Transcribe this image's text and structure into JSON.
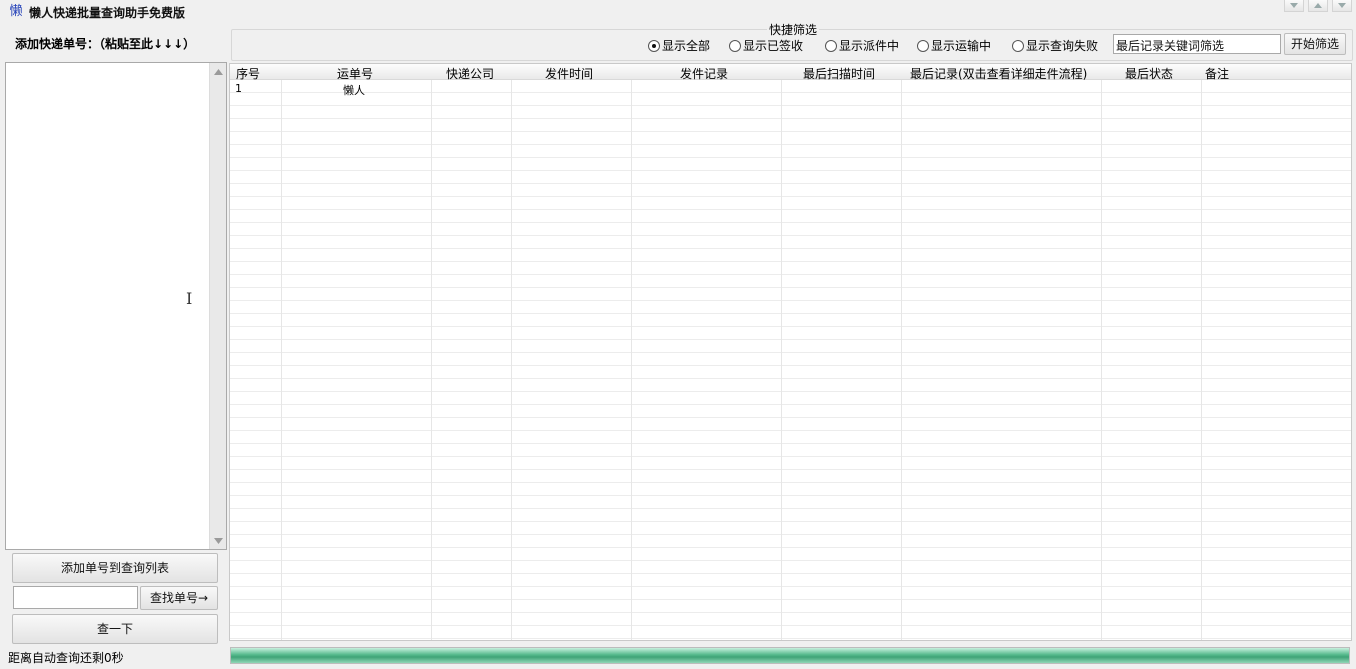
{
  "window": {
    "title": "懒人快递批量查询助手免费版",
    "icon_glyph": "懒"
  },
  "left": {
    "add_label": "添加快递单号：（粘贴至此↓↓↓）",
    "add_button": "添加单号到查询列表",
    "find_input_value": "",
    "find_button": "查找单号→",
    "query_button": "查一下",
    "countdown": "距离自动查询还剩0秒"
  },
  "filter": {
    "title": "快捷筛选",
    "options": [
      "显示全部",
      "显示已签收",
      "显示派件中",
      "显示运输中",
      "显示查询失败"
    ],
    "selected_index": 0,
    "keyword_value": "最后记录关键词筛选",
    "button": "开始筛选"
  },
  "table": {
    "columns": [
      "序号",
      "运单号",
      "快递公司",
      "发件时间",
      "发件记录",
      "最后扫描时间",
      "最后记录(双击查看详细走件流程)",
      "最后状态",
      "备注"
    ],
    "rows": [
      {
        "seq": "1",
        "tracking_no": "懒人",
        "company": "",
        "send_time": "",
        "send_record": "",
        "last_scan": "",
        "last_record": "",
        "last_status": "",
        "note": ""
      }
    ]
  },
  "progress": {
    "fraction": 1.0
  },
  "colors": {
    "progress": "#4fb486",
    "icon": "#2340b8"
  }
}
